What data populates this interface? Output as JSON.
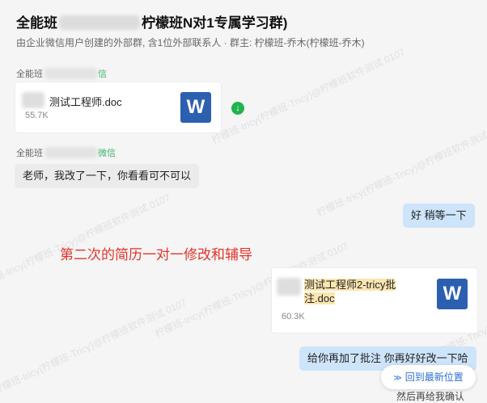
{
  "header": {
    "title_start": "全能班",
    "title_end": "柠檬班N对1专属学习群)",
    "subtitle": "由企业微信用户创建的外部群, 含1位外部联系人 · 群主: 柠檬班-乔木(柠檬班-乔木)"
  },
  "messages": {
    "sender1": {
      "name": "全能班",
      "tag": "信"
    },
    "file1": {
      "name": "测试工程师.doc",
      "size": "55.7K",
      "icon": "W"
    },
    "download_icon": "↓",
    "sender2": {
      "name": "全能班",
      "tag": "微信"
    },
    "text_in": "老师，我改了一下，你看看可不可以",
    "text_out1": "好 稍等一下",
    "file2": {
      "name_line1": "测试工程师2-tricy批",
      "name_line2": "注.doc",
      "size": "60.3K",
      "icon": "W"
    },
    "text_out2": "给你再加了批注 你再好好改一下哈",
    "partial_text": "然后再给我确认"
  },
  "annotation": "第二次的简历一对一修改和辅导",
  "jump_button": {
    "icon": "≫",
    "label": "回到最新位置"
  },
  "watermark": "柠檬班-tricy(柠檬班-Tricy)@柠檬班软件测试 0107",
  "colors": {
    "accent": "#2f6ed4",
    "annotation": "#e4332a",
    "outgoing_bubble": "#cde4fb",
    "word_icon": "#2c5faf"
  }
}
